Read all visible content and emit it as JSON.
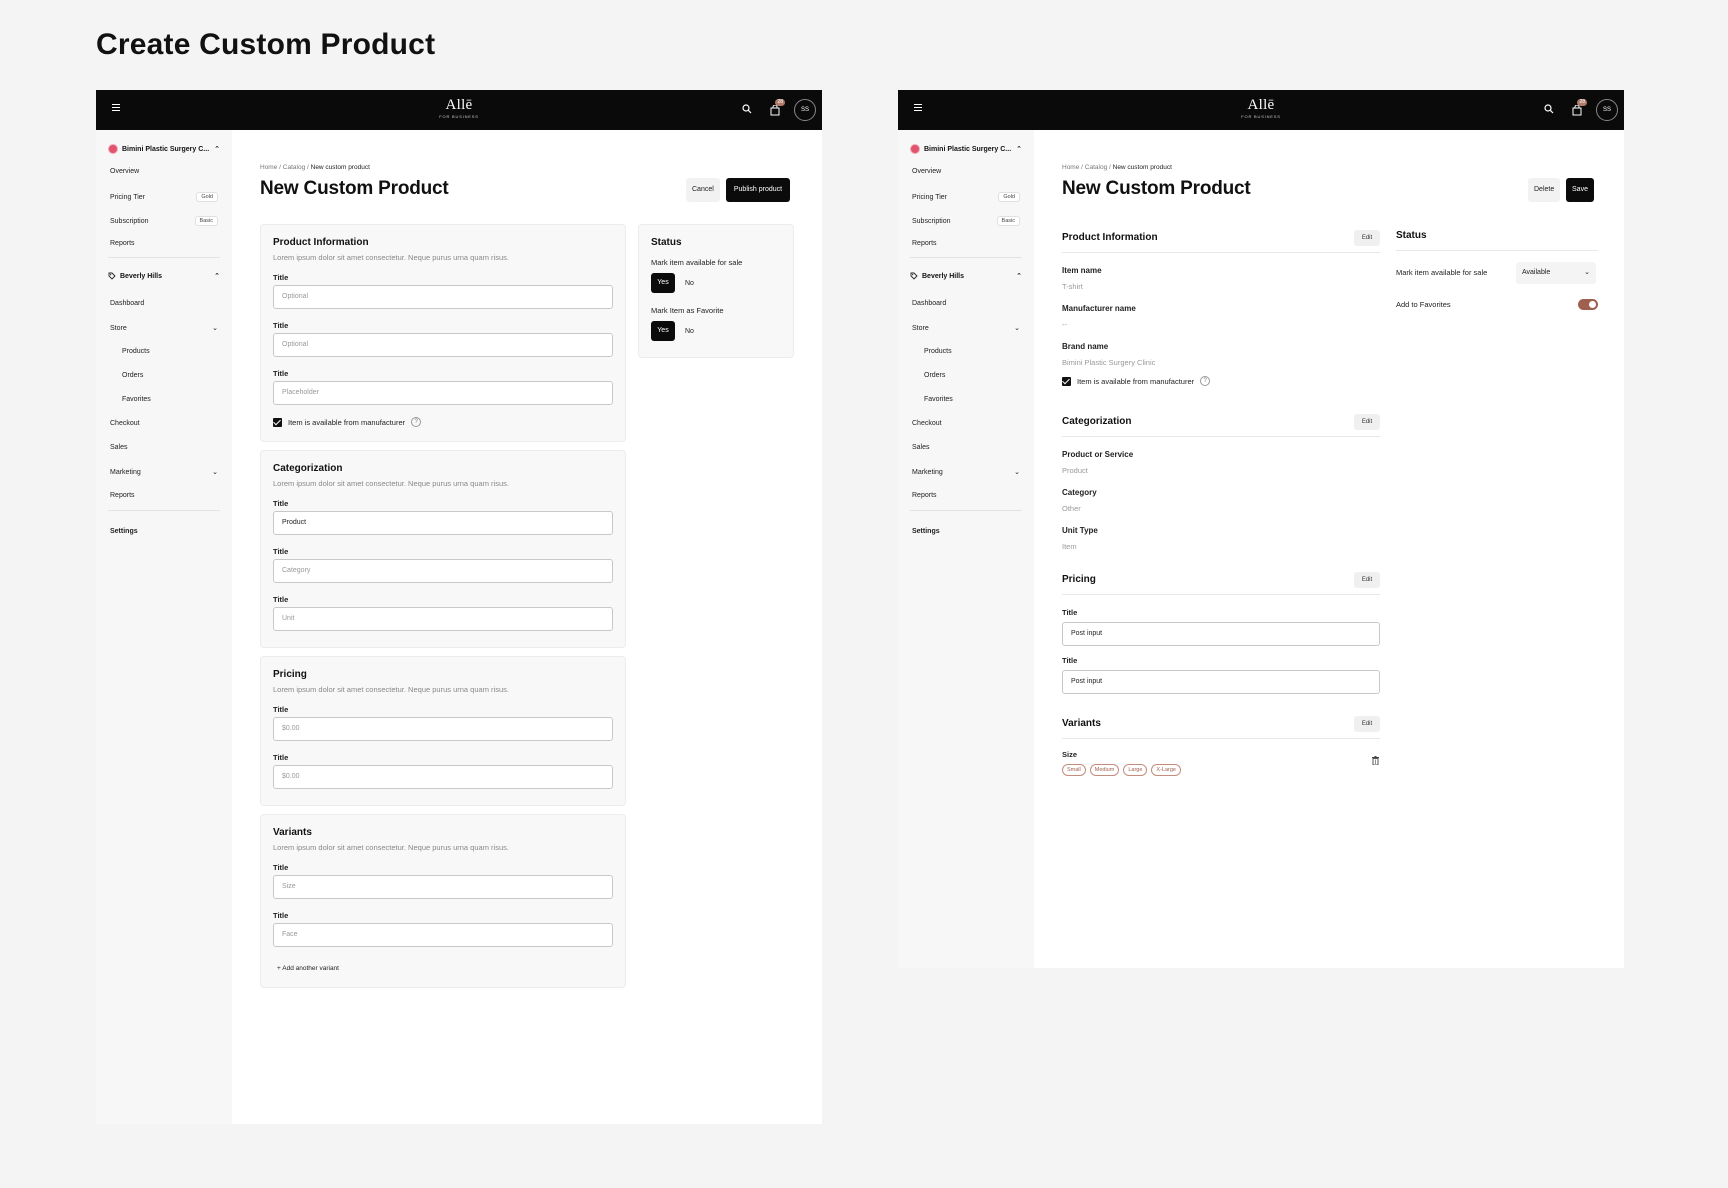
{
  "page_title": "Create Custom Product",
  "colors": {
    "topbar": "#0a0a0a",
    "accent": "#a0604f",
    "org_dot": "#e0546e",
    "primary_button": "#0b0b0b"
  },
  "topbar": {
    "brand": "Allē",
    "brand_sub": "FOR BUSINESS",
    "cart_count": "28",
    "avatar_initials": "SS"
  },
  "sidebar": {
    "org_name": "Bimini Plastic Surgery C...",
    "items_top": [
      {
        "label": "Overview"
      },
      {
        "label": "Pricing Tier",
        "tag": "Gold"
      },
      {
        "label": "Subscription",
        "tag": "Basic"
      },
      {
        "label": "Reports"
      }
    ],
    "location": "Beverly Hills",
    "items_loc": [
      {
        "label": "Dashboard"
      },
      {
        "label": "Store"
      },
      {
        "label": "Products"
      },
      {
        "label": "Orders"
      },
      {
        "label": "Favorites"
      },
      {
        "label": "Checkout"
      },
      {
        "label": "Sales"
      },
      {
        "label": "Marketing"
      },
      {
        "label": "Reports"
      }
    ],
    "settings": "Settings"
  },
  "breadcrumb": {
    "home": "Home",
    "catalog": "Catalog",
    "current": "New custom product",
    "sep": "/"
  },
  "heading": "New Custom Product",
  "left": {
    "cancel": "Cancel",
    "publish": "Publish product",
    "product_info": {
      "title": "Product Information",
      "desc": "Lorem ipsum dolor sit amet consectetur. Neque purus urna quam risus.",
      "fields": [
        {
          "label": "Title",
          "placeholder": "Optional"
        },
        {
          "label": "Title",
          "placeholder": "Optional"
        },
        {
          "label": "Title",
          "placeholder": "Placeholder"
        }
      ],
      "checkbox": "Item is available from manufacturer"
    },
    "categorization": {
      "title": "Categorization",
      "desc": "Lorem ipsum dolor sit amet consectetur. Neque purus urna quam risus.",
      "fields": [
        {
          "label": "Title",
          "value": "Product"
        },
        {
          "label": "Title",
          "placeholder": "Category"
        },
        {
          "label": "Title",
          "placeholder": "Unit"
        }
      ]
    },
    "pricing": {
      "title": "Pricing",
      "desc": "Lorem ipsum dolor sit amet consectetur. Neque purus urna quam risus.",
      "fields": [
        {
          "label": "Title",
          "placeholder": "$0.00"
        },
        {
          "label": "Title",
          "placeholder": "$0.00"
        }
      ]
    },
    "variants": {
      "title": "Variants",
      "desc": "Lorem ipsum dolor sit amet consectetur. Neque purus urna quam risus.",
      "fields": [
        {
          "label": "Title",
          "placeholder": "Size"
        },
        {
          "label": "Title",
          "placeholder": "Face"
        }
      ],
      "add": "+ Add another variant"
    },
    "status": {
      "title": "Status",
      "sale_label": "Mark item available for sale",
      "favorite_label": "Mark Item as Favorite",
      "yes": "Yes",
      "no": "No"
    }
  },
  "right": {
    "delete": "Delete",
    "save": "Save",
    "edit": "Edit",
    "product_info": {
      "title": "Product Information",
      "item_name_label": "Item name",
      "item_name": "T-shirt",
      "manufacturer_label": "Manufacturer name",
      "manufacturer": "--",
      "brand_label": "Brand name",
      "brand": "Bimini Plastic Surgery Clinic",
      "checkbox": "Item is available from manufacturer"
    },
    "categorization": {
      "title": "Categorization",
      "pos_label": "Product or Service",
      "pos": "Product",
      "category_label": "Category",
      "category": "Other",
      "unit_label": "Unit Type",
      "unit": "Item"
    },
    "pricing": {
      "title": "Pricing",
      "fields": [
        {
          "label": "Title",
          "value": "Post input"
        },
        {
          "label": "Title",
          "value": "Post input"
        }
      ]
    },
    "variants": {
      "title": "Variants",
      "size_label": "Size",
      "sizes": [
        "Small",
        "Medium",
        "Large",
        "X-Large"
      ]
    },
    "status": {
      "title": "Status",
      "sale_label": "Mark item available for sale",
      "sale_value": "Available",
      "favorites_label": "Add to Favorites"
    }
  }
}
